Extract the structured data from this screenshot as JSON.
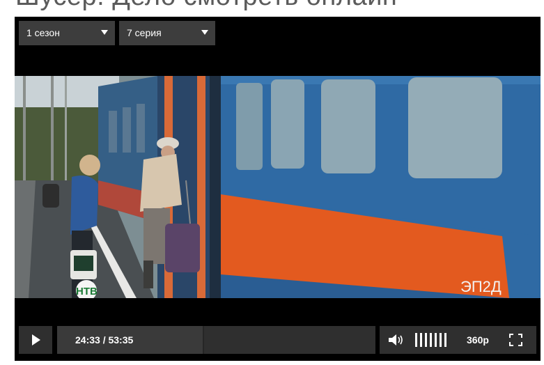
{
  "page": {
    "title": "Шусер. Дело смотреть онлайн"
  },
  "player": {
    "season_select": {
      "value": "1 сезон"
    },
    "episode_select": {
      "value": "7 серия"
    },
    "video": {
      "channel_logo": "НТВ",
      "train_text": "ЭП2Д"
    },
    "controls": {
      "play_icon": "play-icon",
      "time": "24:33 / 53:35",
      "progress": 0.458,
      "volume_icon": "volume-icon",
      "volume_level": 1.0,
      "quality": "360p",
      "fullscreen_icon": "fullscreen-icon"
    }
  },
  "colors": {
    "control_bg": "#2f2f2f",
    "dropdown_bg": "#3d3d3d",
    "player_bg": "#000000"
  }
}
